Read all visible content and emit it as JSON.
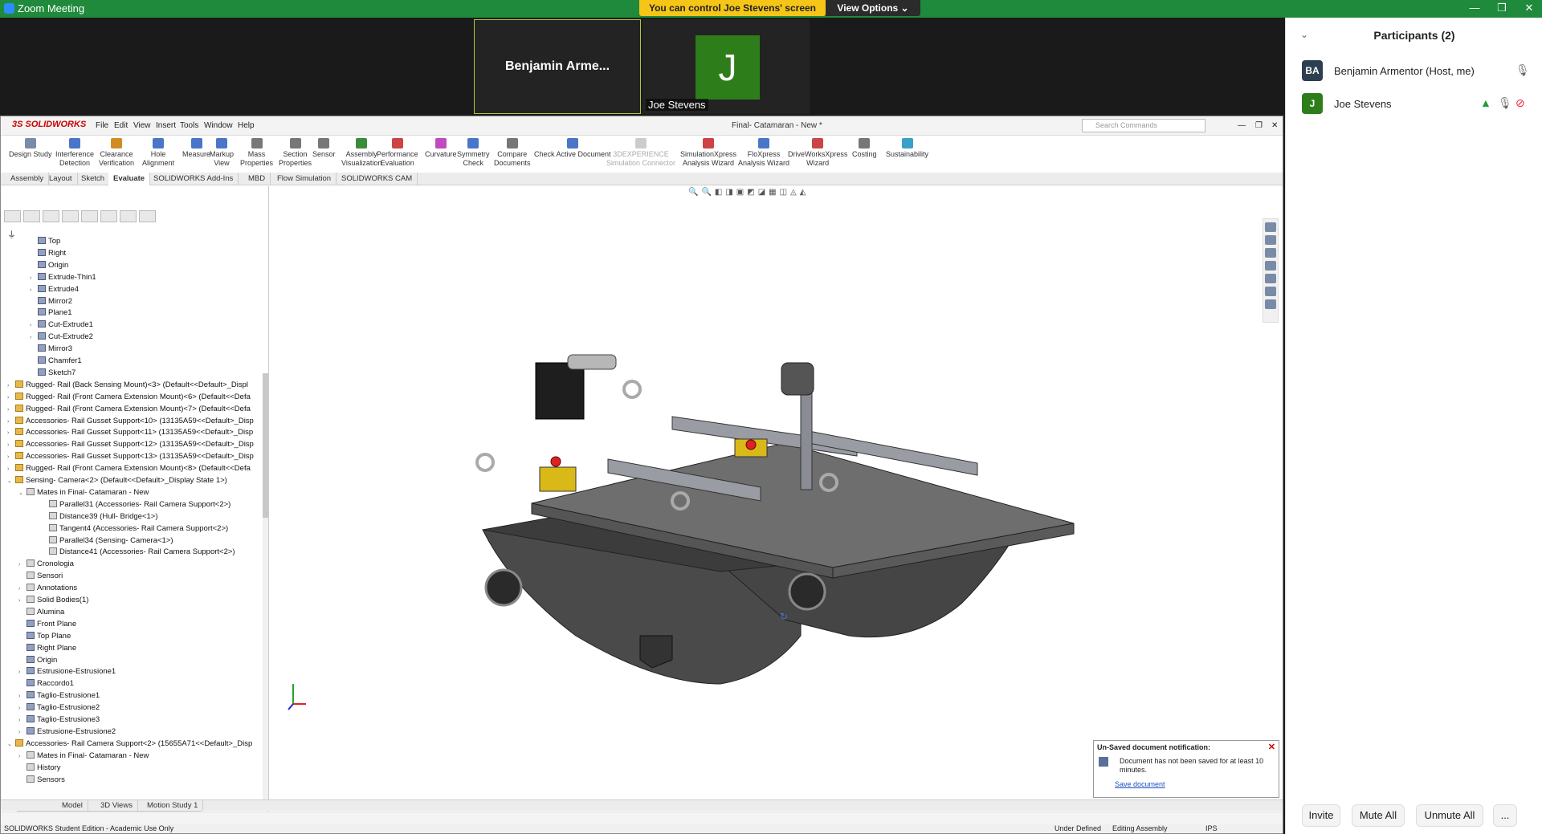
{
  "zoom": {
    "window_title": "Zoom Meeting",
    "control_banner": "You can control Joe Stevens' screen",
    "view_options": "View Options ⌄",
    "min": "—",
    "restore": "❐",
    "close": "✕"
  },
  "video": {
    "tile_ben_name": "Benjamin Arme...",
    "tile_joe_initial": "J",
    "tile_joe_name": "Joe Stevens"
  },
  "participants": {
    "title": "Participants (2)",
    "list": [
      {
        "initials": "BA",
        "name": "Benjamin Armentor (Host, me)",
        "color": "#2d3e50"
      },
      {
        "initials": "J",
        "name": "Joe Stevens",
        "color": "#2e7d1b"
      }
    ],
    "invite": "Invite",
    "mute_all": "Mute All",
    "unmute_all": "Unmute All",
    "more": "..."
  },
  "solidworks": {
    "logo": "3S SOLIDWORKS",
    "menus": [
      "File",
      "Edit",
      "View",
      "Insert",
      "Tools",
      "Window",
      "Help"
    ],
    "document_title": "Final- Catamaran - New *",
    "search_placeholder": "Search Commands",
    "ribbon": [
      {
        "label": "Design Study",
        "color": "#7a8ba8"
      },
      {
        "label": "Interference\nDetection",
        "color": "#4a76c9"
      },
      {
        "label": "Clearance\nVerification",
        "color": "#d28b24"
      },
      {
        "label": "Hole\nAlignment",
        "color": "#4a76c9"
      },
      {
        "label": "Measure",
        "color": "#4a76c9"
      },
      {
        "label": "Markup\nView",
        "color": "#4a76c9"
      },
      {
        "label": "Mass\nProperties",
        "color": "#777777"
      },
      {
        "label": "Section\nProperties",
        "color": "#777777"
      },
      {
        "label": "Sensor",
        "color": "#777777"
      },
      {
        "label": "Assembly\nVisualization",
        "color": "#3c8b3c"
      },
      {
        "label": "Performance\nEvaluation",
        "color": "#c44"
      },
      {
        "label": "Curvature",
        "color": "#c04bc0"
      },
      {
        "label": "Symmetry\nCheck",
        "color": "#4a76c9"
      },
      {
        "label": "Compare\nDocuments",
        "color": "#777777"
      },
      {
        "label": "Check Active Document",
        "color": "#4a76c9"
      },
      {
        "label": "3DEXPERIENCE\nSimulation Connector",
        "color": "#cccccc",
        "disabled": true
      },
      {
        "label": "SimulationXpress\nAnalysis Wizard",
        "color": "#c44"
      },
      {
        "label": "FloXpress\nAnalysis Wizard",
        "color": "#4a76c9"
      },
      {
        "label": "DriveWorksXpress\nWizard",
        "color": "#c44"
      },
      {
        "label": "Costing",
        "color": "#777777"
      },
      {
        "label": "Sustainability",
        "color": "#3aa0c9"
      }
    ],
    "tabs": [
      "Assembly",
      "Layout",
      "Sketch",
      "Evaluate",
      "SOLIDWORKS Add-Ins",
      "MBD",
      "Flow Simulation",
      "SOLIDWORKS CAM"
    ],
    "active_tab": "Evaluate",
    "tree": [
      {
        "label": "Top",
        "indent": 2,
        "icon": "plane"
      },
      {
        "label": "Right",
        "indent": 2,
        "icon": "plane"
      },
      {
        "label": "Origin",
        "indent": 2,
        "icon": "origin"
      },
      {
        "label": "Extrude-Thin1",
        "indent": 2,
        "icon": "feat",
        "exp": "›"
      },
      {
        "label": "Extrude4",
        "indent": 2,
        "icon": "feat",
        "exp": "›"
      },
      {
        "label": "Mirror2",
        "indent": 2,
        "icon": "feat"
      },
      {
        "label": "Plane1",
        "indent": 2,
        "icon": "plane"
      },
      {
        "label": "Cut-Extrude1",
        "indent": 2,
        "icon": "feat",
        "exp": "›"
      },
      {
        "label": "Cut-Extrude2",
        "indent": 2,
        "icon": "feat",
        "exp": "›"
      },
      {
        "label": "Mirror3",
        "indent": 2,
        "icon": "feat"
      },
      {
        "label": "Chamfer1",
        "indent": 2,
        "icon": "feat"
      },
      {
        "label": "Sketch7",
        "indent": 2,
        "icon": "sketch"
      },
      {
        "label": "Rugged- Rail (Back Sensing Mount)<3> (Default<<Default>_Displ",
        "indent": 0,
        "icon": "asm",
        "exp": "›"
      },
      {
        "label": "Rugged- Rail (Front Camera Extension Mount)<6> (Default<<Defa",
        "indent": 0,
        "icon": "asm",
        "exp": "›"
      },
      {
        "label": "Rugged- Rail (Front Camera Extension Mount)<7> (Default<<Defa",
        "indent": 0,
        "icon": "asm",
        "exp": "›"
      },
      {
        "label": "Accessories- Rail Gusset Support<10> (13135A59<<Default>_Disp",
        "indent": 0,
        "icon": "asm",
        "exp": "›"
      },
      {
        "label": "Accessories- Rail Gusset Support<11> (13135A59<<Default>_Disp",
        "indent": 0,
        "icon": "asm",
        "exp": "›"
      },
      {
        "label": "Accessories- Rail Gusset Support<12> (13135A59<<Default>_Disp",
        "indent": 0,
        "icon": "asm",
        "exp": "›"
      },
      {
        "label": "Accessories- Rail Gusset Support<13> (13135A59<<Default>_Disp",
        "indent": 0,
        "icon": "asm",
        "exp": "›"
      },
      {
        "label": "Rugged- Rail (Front Camera Extension Mount)<8> (Default<<Defa",
        "indent": 0,
        "icon": "asm",
        "exp": "›"
      },
      {
        "label": "Sensing- Camera<2> (Default<<Default>_Display State 1>)",
        "indent": 0,
        "icon": "asm",
        "exp": "⌄"
      },
      {
        "label": "Mates in Final- Catamaran - New",
        "indent": 1,
        "icon": "mate",
        "exp": "⌄"
      },
      {
        "label": "Parallel31 (Accessories- Rail Camera Support<2>)",
        "indent": 3,
        "icon": "mate"
      },
      {
        "label": "Distance39 (Hull- Bridge<1>)",
        "indent": 3,
        "icon": "mate",
        "extra": true
      },
      {
        "label": "Tangent4 (Accessories- Rail Camera Support<2>)",
        "indent": 3,
        "icon": "mate"
      },
      {
        "label": "Parallel34 (Sensing- Camera<1>)",
        "indent": 3,
        "icon": "mate"
      },
      {
        "label": "Distance41 (Accessories- Rail Camera Support<2>)",
        "indent": 3,
        "icon": "mate"
      },
      {
        "label": "Cronologia",
        "indent": 1,
        "icon": "mate",
        "exp": "›"
      },
      {
        "label": "Sensori",
        "indent": 1,
        "icon": "mate"
      },
      {
        "label": "Annotations",
        "indent": 1,
        "icon": "mate",
        "exp": "›"
      },
      {
        "label": "Solid Bodies(1)",
        "indent": 1,
        "icon": "mate",
        "exp": "›"
      },
      {
        "label": "Alumina",
        "indent": 1,
        "icon": "mate"
      },
      {
        "label": "Front Plane",
        "indent": 1,
        "icon": "plane"
      },
      {
        "label": "Top Plane",
        "indent": 1,
        "icon": "plane"
      },
      {
        "label": "Right Plane",
        "indent": 1,
        "icon": "plane"
      },
      {
        "label": "Origin",
        "indent": 1,
        "icon": "origin"
      },
      {
        "label": "Estrusione-Estrusione1",
        "indent": 1,
        "icon": "feat",
        "exp": "›"
      },
      {
        "label": "Raccordo1",
        "indent": 1,
        "icon": "feat"
      },
      {
        "label": "Taglio-Estrusione1",
        "indent": 1,
        "icon": "feat",
        "exp": "›"
      },
      {
        "label": "Taglio-Estrusione2",
        "indent": 1,
        "icon": "feat",
        "exp": "›"
      },
      {
        "label": "Taglio-Estrusione3",
        "indent": 1,
        "icon": "feat",
        "exp": "›"
      },
      {
        "label": "Estrusione-Estrusione2",
        "indent": 1,
        "icon": "feat",
        "exp": "›"
      },
      {
        "label": "Accessories- Rail Camera Support<2> (15655A71<<Default>_Disp",
        "indent": 0,
        "icon": "asm",
        "exp": "⌄"
      },
      {
        "label": "Mates in Final- Catamaran - New",
        "indent": 1,
        "icon": "mate",
        "exp": "›"
      },
      {
        "label": "History",
        "indent": 1,
        "icon": "mate"
      },
      {
        "label": "Sensors",
        "indent": 1,
        "icon": "mate"
      }
    ],
    "notification": {
      "title": "Un-Saved document notification:",
      "body": "Document has not been saved for at least 10 minutes.",
      "link": "Save document",
      "close": "✕"
    },
    "bottom_tabs": [
      "Model",
      "3D Views",
      "Motion Study 1"
    ],
    "active_bottom_tab": "Model",
    "status": {
      "left": "SOLIDWORKS Student Edition - Academic Use Only",
      "state": "Under Defined",
      "mode": "Editing Assembly",
      "units": "IPS"
    }
  }
}
